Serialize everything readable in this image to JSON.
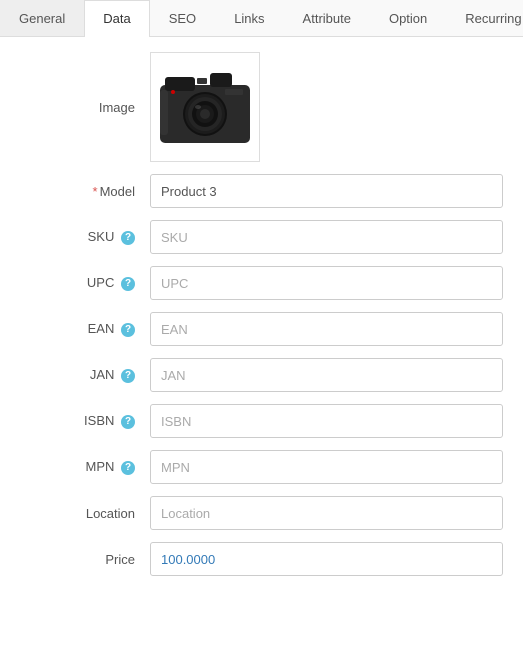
{
  "tabs": [
    {
      "label": "General",
      "active": false
    },
    {
      "label": "Data",
      "active": true
    },
    {
      "label": "SEO",
      "active": false
    },
    {
      "label": "Links",
      "active": false
    },
    {
      "label": "Attribute",
      "active": false
    },
    {
      "label": "Option",
      "active": false
    },
    {
      "label": "Recurring",
      "active": false
    }
  ],
  "form": {
    "image_label": "Image",
    "model_label": "Model",
    "model_required": "*",
    "model_value": "Product 3",
    "sku_label": "SKU",
    "sku_placeholder": "SKU",
    "upc_label": "UPC",
    "upc_placeholder": "UPC",
    "ean_label": "EAN",
    "ean_placeholder": "EAN",
    "jan_label": "JAN",
    "jan_placeholder": "JAN",
    "isbn_label": "ISBN",
    "isbn_placeholder": "ISBN",
    "mpn_label": "MPN",
    "mpn_placeholder": "MPN",
    "location_label": "Location",
    "location_placeholder": "Location",
    "price_label": "Price",
    "price_value": "100.0000"
  }
}
